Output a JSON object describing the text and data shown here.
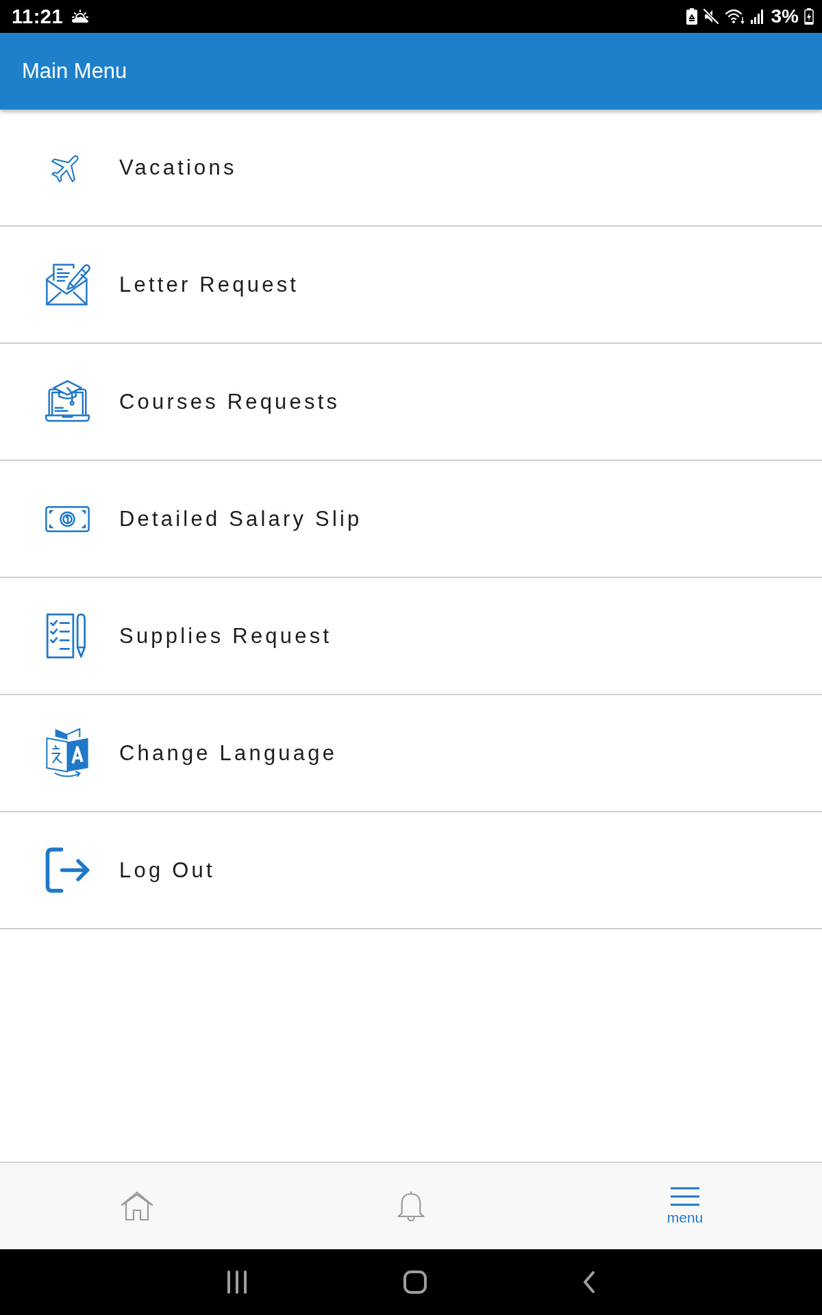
{
  "status_bar": {
    "time": "11:21",
    "battery": "3%"
  },
  "app_bar": {
    "title": "Main Menu"
  },
  "menu_items": [
    {
      "label": "Vacations",
      "kind": "plane"
    },
    {
      "label": "Letter Request",
      "kind": "letter"
    },
    {
      "label": "Courses Requests",
      "kind": "course"
    },
    {
      "label": "Detailed Salary Slip",
      "kind": "money"
    },
    {
      "label": "Supplies Request",
      "kind": "checklist"
    },
    {
      "label": "Change Language",
      "kind": "language"
    },
    {
      "label": "Log Out",
      "kind": "logout"
    }
  ],
  "bottom_nav": [
    {
      "kind": "home",
      "selected": false
    },
    {
      "kind": "bell",
      "selected": false
    },
    {
      "kind": "menu",
      "label": "menu",
      "selected": true
    }
  ]
}
